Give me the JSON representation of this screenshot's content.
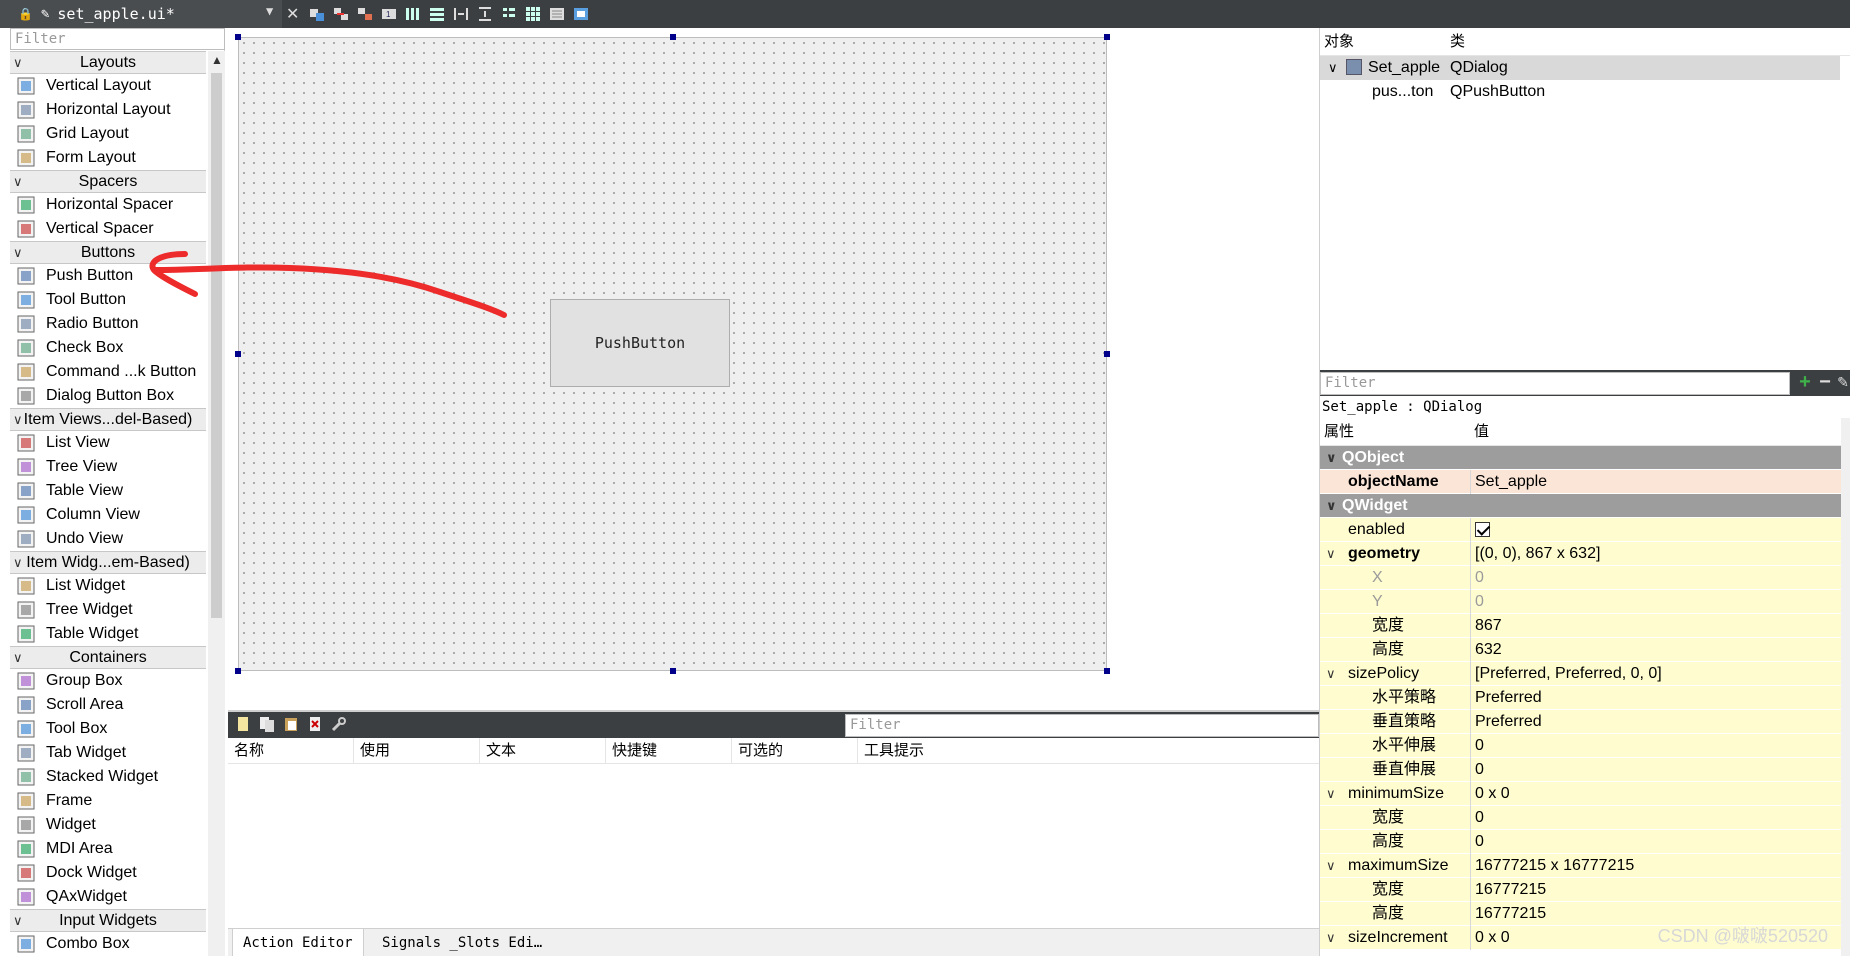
{
  "tab": {
    "title": "set_apple.ui*"
  },
  "widget_box": {
    "filter_placeholder": "Filter",
    "sections": [
      {
        "type": "category",
        "label": "Layouts"
      },
      {
        "type": "item",
        "label": "Vertical Layout",
        "icon": "vertical-layout-icon"
      },
      {
        "type": "item",
        "label": "Horizontal Layout",
        "icon": "horizontal-layout-icon"
      },
      {
        "type": "item",
        "label": "Grid Layout",
        "icon": "grid-layout-icon"
      },
      {
        "type": "item",
        "label": "Form Layout",
        "icon": "form-layout-icon"
      },
      {
        "type": "category",
        "label": "Spacers"
      },
      {
        "type": "item",
        "label": "Horizontal Spacer",
        "icon": "horizontal-spacer-icon"
      },
      {
        "type": "item",
        "label": "Vertical Spacer",
        "icon": "vertical-spacer-icon"
      },
      {
        "type": "category",
        "label": "Buttons"
      },
      {
        "type": "item",
        "label": "Push Button",
        "icon": "push-button-icon"
      },
      {
        "type": "item",
        "label": "Tool Button",
        "icon": "tool-button-icon"
      },
      {
        "type": "item",
        "label": "Radio Button",
        "icon": "radio-button-icon"
      },
      {
        "type": "item",
        "label": "Check Box",
        "icon": "check-box-icon"
      },
      {
        "type": "item",
        "label": "Command ...k Button",
        "icon": "command-link-icon"
      },
      {
        "type": "item",
        "label": "Dialog Button Box",
        "icon": "dialog-button-box-icon"
      },
      {
        "type": "category",
        "label": "Item Views...del-Based)"
      },
      {
        "type": "item",
        "label": "List View",
        "icon": "list-view-icon"
      },
      {
        "type": "item",
        "label": "Tree View",
        "icon": "tree-view-icon"
      },
      {
        "type": "item",
        "label": "Table View",
        "icon": "table-view-icon"
      },
      {
        "type": "item",
        "label": "Column View",
        "icon": "column-view-icon"
      },
      {
        "type": "item",
        "label": "Undo View",
        "icon": "undo-view-icon"
      },
      {
        "type": "category",
        "label": "Item Widg...em-Based)"
      },
      {
        "type": "item",
        "label": "List Widget",
        "icon": "list-widget-icon"
      },
      {
        "type": "item",
        "label": "Tree Widget",
        "icon": "tree-widget-icon"
      },
      {
        "type": "item",
        "label": "Table Widget",
        "icon": "table-widget-icon"
      },
      {
        "type": "category",
        "label": "Containers"
      },
      {
        "type": "item",
        "label": "Group Box",
        "icon": "group-box-icon"
      },
      {
        "type": "item",
        "label": "Scroll Area",
        "icon": "scroll-area-icon"
      },
      {
        "type": "item",
        "label": "Tool Box",
        "icon": "tool-box-icon"
      },
      {
        "type": "item",
        "label": "Tab Widget",
        "icon": "tab-widget-icon"
      },
      {
        "type": "item",
        "label": "Stacked Widget",
        "icon": "stacked-widget-icon"
      },
      {
        "type": "item",
        "label": "Frame",
        "icon": "frame-icon"
      },
      {
        "type": "item",
        "label": "Widget",
        "icon": "widget-icon"
      },
      {
        "type": "item",
        "label": "MDI Area",
        "icon": "mdi-area-icon"
      },
      {
        "type": "item",
        "label": "Dock Widget",
        "icon": "dock-widget-icon"
      },
      {
        "type": "item",
        "label": "QAxWidget",
        "icon": "qaxwidget-icon"
      },
      {
        "type": "category",
        "label": "Input Widgets"
      },
      {
        "type": "item",
        "label": "Combo Box",
        "icon": "combo-box-icon"
      }
    ]
  },
  "form": {
    "push_button_text": "PushButton"
  },
  "action_editor": {
    "filter_placeholder": "Filter",
    "columns": [
      "名称",
      "使用",
      "文本",
      "快捷键",
      "可选的",
      "工具提示"
    ],
    "tabs": [
      "Action Editor",
      "Signals _Slots Edi…"
    ]
  },
  "object_inspector": {
    "columns": [
      "对象",
      "类"
    ],
    "rows": [
      {
        "object": "Set_apple",
        "class": "QDialog"
      },
      {
        "object": "pus...ton",
        "class": "QPushButton"
      }
    ]
  },
  "property_editor": {
    "filter_placeholder": "Filter",
    "class_label": "Set_apple : QDialog",
    "columns": [
      "属性",
      "值"
    ],
    "rows": [
      {
        "kind": "group",
        "name": "QObject"
      },
      {
        "kind": "obj",
        "name": "objectName",
        "value": "Set_apple",
        "bold": true
      },
      {
        "kind": "group",
        "name": "QWidget"
      },
      {
        "kind": "wid",
        "name": "enabled",
        "value": "",
        "checkbox": true
      },
      {
        "kind": "wid",
        "name": "geometry",
        "value": "[(0, 0), 867 x 632]",
        "bold": true,
        "toggle": true
      },
      {
        "kind": "wid",
        "name": "X",
        "value": "0",
        "sub": true,
        "disabled": true
      },
      {
        "kind": "wid",
        "name": "Y",
        "value": "0",
        "sub": true,
        "disabled": true
      },
      {
        "kind": "wid",
        "name": "宽度",
        "value": "867",
        "sub": true
      },
      {
        "kind": "wid",
        "name": "高度",
        "value": "632",
        "sub": true
      },
      {
        "kind": "wid",
        "name": "sizePolicy",
        "value": "[Preferred, Preferred, 0, 0]",
        "toggle": true
      },
      {
        "kind": "wid",
        "name": "水平策略",
        "value": "Preferred",
        "sub": true
      },
      {
        "kind": "wid",
        "name": "垂直策略",
        "value": "Preferred",
        "sub": true
      },
      {
        "kind": "wid",
        "name": "水平伸展",
        "value": "0",
        "sub": true
      },
      {
        "kind": "wid",
        "name": "垂直伸展",
        "value": "0",
        "sub": true
      },
      {
        "kind": "wid",
        "name": "minimumSize",
        "value": "0 x 0",
        "toggle": true
      },
      {
        "kind": "wid",
        "name": "宽度",
        "value": "0",
        "sub": true
      },
      {
        "kind": "wid",
        "name": "高度",
        "value": "0",
        "sub": true
      },
      {
        "kind": "wid",
        "name": "maximumSize",
        "value": "16777215 x 16777215",
        "toggle": true
      },
      {
        "kind": "wid",
        "name": "宽度",
        "value": "16777215",
        "sub": true
      },
      {
        "kind": "wid",
        "name": "高度",
        "value": "16777215",
        "sub": true
      },
      {
        "kind": "wid",
        "name": "sizeIncrement",
        "value": "0 x 0",
        "toggle": true
      }
    ]
  },
  "watermark": "CSDN @啵啵520520"
}
